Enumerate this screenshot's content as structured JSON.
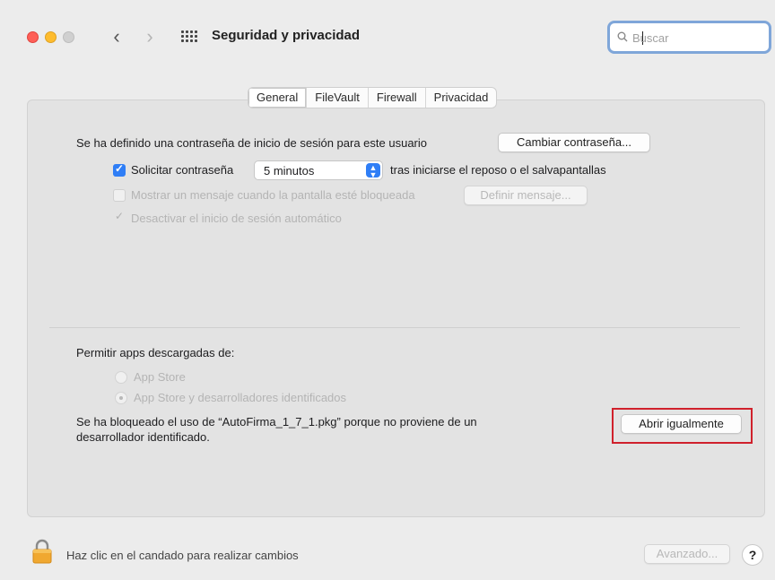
{
  "window": {
    "title": "Seguridad y privacidad",
    "nav_back": "‹",
    "nav_forward": "›"
  },
  "search": {
    "placeholder": "Buscar",
    "value": ""
  },
  "tabs": [
    {
      "label": "General",
      "active": true
    },
    {
      "label": "FileVault",
      "active": false
    },
    {
      "label": "Firewall",
      "active": false
    },
    {
      "label": "Privacidad",
      "active": false
    }
  ],
  "general": {
    "password_text": "Se ha definido una contraseña de inicio de sesión para este usuario",
    "change_password_button": "Cambiar contraseña...",
    "require_password": {
      "label": "Solicitar contraseña",
      "checked": true,
      "delay_value": "5 minutos",
      "after_text": "tras iniciarse el reposo o el salvapantallas"
    },
    "show_message": {
      "label": "Mostrar un mensaje cuando la pantalla esté bloqueada",
      "checked": false,
      "enabled": false,
      "button": "Definir mensaje..."
    },
    "disable_autologin": {
      "label": "Desactivar el inicio de sesión automático",
      "checked": true,
      "enabled": false
    }
  },
  "downloads": {
    "heading": "Permitir apps descargadas de:",
    "options": [
      {
        "label": "App Store",
        "selected": false
      },
      {
        "label": "App Store y desarrolladores identificados",
        "selected": true
      }
    ],
    "blocked_line1": "Se ha bloqueado el uso de “AutoFirma_1_7_1.pkg” porque no proviene de un",
    "blocked_line2": "desarrollador identificado.",
    "open_anyway_button": "Abrir igualmente"
  },
  "footer": {
    "lock_text": "Haz clic en el candado para realizar cambios",
    "advanced_button": "Avanzado...",
    "help_button": "?"
  },
  "colors": {
    "accent": "#2f7ef6",
    "highlight_box": "#d0212c",
    "lock": "#f0a830"
  }
}
